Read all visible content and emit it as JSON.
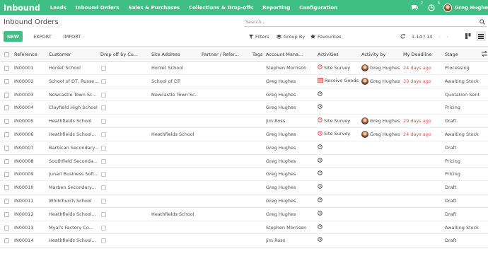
{
  "app": {
    "brand": "Inbound",
    "menu": [
      "Leads",
      "Inbound Orders",
      "Sales & Purchases",
      "Collections & Drop-offs",
      "Reporting",
      "Configuration"
    ],
    "chat_badge": "2",
    "activity_badge": "6",
    "user": "Greg Hughe"
  },
  "page": {
    "breadcrumb": "Inbound Orders",
    "search_placeholder": "Search...",
    "btn_new": "NEW",
    "btn_export": "EXPORT",
    "btn_import": "IMPORT",
    "filters": "Filters",
    "group_by": "Group By",
    "favourites": "Favourites",
    "pager": "1-14 / 14"
  },
  "columns": [
    "Reference",
    "Customer",
    "Drop off by Cu...",
    "Site Address",
    "Partner / Refer...",
    "Tags",
    "Account Mana...",
    "Activities",
    "Activity by",
    "My Deadline",
    "Stage"
  ],
  "rows": [
    {
      "ref": "IN00001",
      "customer": "Honlet School",
      "site": "Honlet School",
      "manager": "Stephen Morrison",
      "activity": "Site Survey",
      "act_type": "survey",
      "by": "Greg Hughes",
      "deadline": "24 days ago",
      "stage": "Processing"
    },
    {
      "ref": "IN00002",
      "customer": "School of DT, Russe...",
      "site": "School of DT",
      "manager": "Greg Hughes",
      "activity": "Receive Goods",
      "act_type": "receive",
      "by": "Greg Hughes",
      "deadline": "33 days ago",
      "stage": "Awaiting Stock"
    },
    {
      "ref": "IN00003",
      "customer": "Newcastle Town Sc...",
      "site": "Newcastle Town Sc...",
      "manager": "Greg Hughes",
      "activity": "",
      "act_type": "clock",
      "by": "",
      "deadline": "",
      "stage": "Quotation Sent"
    },
    {
      "ref": "IN00004",
      "customer": "Clayfield High School",
      "site": "",
      "manager": "Greg Hughes",
      "activity": "",
      "act_type": "clock",
      "by": "",
      "deadline": "",
      "stage": "Pricing"
    },
    {
      "ref": "IN00005",
      "customer": "Heathfields School",
      "site": "",
      "manager": "Jim Ross",
      "activity": "Site Survey",
      "act_type": "survey",
      "by": "Greg Hughes",
      "deadline": "29 days ago",
      "stage": "Draft"
    },
    {
      "ref": "IN00006",
      "customer": "Heathfields School...",
      "site": "Heathfields School",
      "manager": "Greg Hughes",
      "activity": "Site Survey",
      "act_type": "survey",
      "by": "Greg Hughes",
      "deadline": "24 days ago",
      "stage": "Awaiting Stock"
    },
    {
      "ref": "IN00007",
      "customer": "Barbican Secondary...",
      "site": "",
      "manager": "Greg Hughes",
      "activity": "",
      "act_type": "clock",
      "by": "",
      "deadline": "",
      "stage": "Draft"
    },
    {
      "ref": "IN00008",
      "customer": "Southfield Seconda...",
      "site": "",
      "manager": "Greg Hughes",
      "activity": "",
      "act_type": "clock",
      "by": "",
      "deadline": "",
      "stage": "Pricing"
    },
    {
      "ref": "IN00009",
      "customer": "Junari Business Soft...",
      "site": "",
      "manager": "Greg Hughes",
      "activity": "",
      "act_type": "clock",
      "by": "",
      "deadline": "",
      "stage": "Pricing"
    },
    {
      "ref": "IN00010",
      "customer": "Marben Secondary...",
      "site": "",
      "manager": "Greg Hughes",
      "activity": "",
      "act_type": "clock",
      "by": "",
      "deadline": "",
      "stage": "Draft"
    },
    {
      "ref": "IN00011",
      "customer": "Whitchurch School",
      "site": "",
      "manager": "Greg Hughes",
      "activity": "",
      "act_type": "clock",
      "by": "",
      "deadline": "",
      "stage": "Draft"
    },
    {
      "ref": "IN00012",
      "customer": "Heathfields School...",
      "site": "Heathfields School",
      "manager": "Greg Hughes",
      "activity": "",
      "act_type": "clock",
      "by": "",
      "deadline": "",
      "stage": "Draft"
    },
    {
      "ref": "IN00013",
      "customer": "Myal's Factory Co...",
      "site": "",
      "manager": "Stephen Morrison",
      "activity": "",
      "act_type": "clock",
      "by": "",
      "deadline": "",
      "stage": "Awaiting Stock"
    },
    {
      "ref": "IN00014",
      "customer": "Heathfields School...",
      "site": "",
      "manager": "Jim Ross",
      "activity": "",
      "act_type": "clock",
      "by": "",
      "deadline": "",
      "stage": "Draft"
    }
  ],
  "colors": {
    "brand": "#3fbf84",
    "late": "#d9534f"
  }
}
